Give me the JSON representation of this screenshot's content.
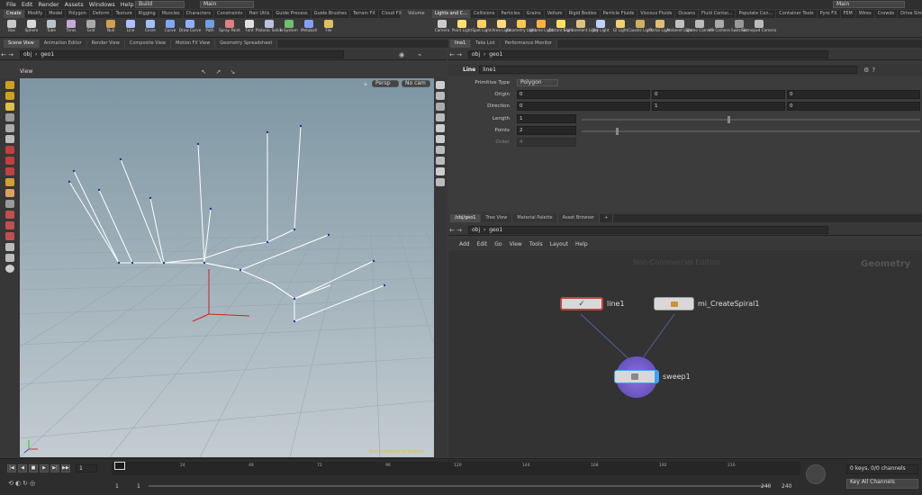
{
  "menu": {
    "items": [
      "File",
      "Edit",
      "Render",
      "Assets",
      "Windows",
      "Help"
    ],
    "build": "Build",
    "desktop": "Main",
    "right_desktop": "Main"
  },
  "shelf_tabs_left": [
    "Create",
    "Modify",
    "Model",
    "Polygon",
    "Deform",
    "Texture",
    "Rigging",
    "Muscles",
    "Characters",
    "Constraints",
    "Hair Utils",
    "Guide Process",
    "Guide Brushes",
    "Terrain FX",
    "Cloud FX",
    "Volume"
  ],
  "shelf_tabs_right": [
    "Lights and C...",
    "Collisions",
    "Particles",
    "Grains",
    "Vellum",
    "Rigid Bodies",
    "Particle Fluids",
    "Viscous Fluids",
    "Oceans",
    "Fluid Contai...",
    "Populate Con...",
    "Container Tools",
    "Pyro FX",
    "FEM",
    "Wires",
    "Crowds",
    "Drive Simula..."
  ],
  "tools_left": [
    {
      "label": "Box",
      "color": "#c9c9c9"
    },
    {
      "label": "Sphere",
      "color": "#d9d9d9"
    },
    {
      "label": "Tube",
      "color": "#b8c4cc"
    },
    {
      "label": "Torus",
      "color": "#c7a8d8"
    },
    {
      "label": "Grid",
      "color": "#a9a9a9"
    },
    {
      "label": "Null",
      "color": "#d0a050"
    },
    {
      "label": "Line",
      "color": "#b0c0ff"
    },
    {
      "label": "Circle",
      "color": "#a0c0ff"
    },
    {
      "label": "Curve",
      "color": "#7fa8ff"
    },
    {
      "label": "Draw Curve",
      "color": "#8fb0ff"
    },
    {
      "label": "Path",
      "color": "#6fa0e0"
    },
    {
      "label": "Spray Paint",
      "color": "#e08080"
    },
    {
      "label": "Font",
      "color": "#e0e0e0"
    },
    {
      "label": "Platonic Solids",
      "color": "#c0c0e0"
    },
    {
      "label": "L-System",
      "color": "#70c070"
    },
    {
      "label": "Metaball",
      "color": "#80a0ff"
    },
    {
      "label": "File",
      "color": "#e0c060"
    }
  ],
  "tools_right": [
    {
      "label": "Camera",
      "color": "#cccccc"
    },
    {
      "label": "Point Light",
      "color": "#ffe070"
    },
    {
      "label": "Spot Light",
      "color": "#ffd060"
    },
    {
      "label": "Area Light",
      "color": "#ffd880"
    },
    {
      "label": "Geometry Light",
      "color": "#ffc850"
    },
    {
      "label": "Volume Light",
      "color": "#ffb040"
    },
    {
      "label": "Distant Light",
      "color": "#ffe060"
    },
    {
      "label": "Environment Light",
      "color": "#e0c080"
    },
    {
      "label": "Sky Light",
      "color": "#c0d0ff"
    },
    {
      "label": "GI Light",
      "color": "#f0d070"
    },
    {
      "label": "Caustic Light",
      "color": "#d0b060"
    },
    {
      "label": "Portal Light",
      "color": "#e0c070"
    },
    {
      "label": "Ambient Light",
      "color": "#c0c0c0"
    },
    {
      "label": "Stereo Camera",
      "color": "#bbbbbb"
    },
    {
      "label": "VR Camera",
      "color": "#aaaaaa"
    },
    {
      "label": "Switcher",
      "color": "#999999"
    },
    {
      "label": "Gamepad Camera",
      "color": "#bbbbbb"
    }
  ],
  "viewer": {
    "tabs": [
      "Scene View",
      "Animation Editor",
      "Render View",
      "Composite View",
      "Motion FX View",
      "Geometry Spreadsheet"
    ],
    "path_obj": "obj",
    "path_geo": "geo1",
    "view_label": "View",
    "persp": "Persp",
    "cam": "No cam",
    "watermark": "Non-Commercial Edition"
  },
  "params": {
    "tabs": [
      "line1",
      "Take List",
      "Performance Monitor"
    ],
    "path_obj": "obj",
    "path_geo": "geo1",
    "node_type": "Line",
    "node_name": "line1",
    "primitive_type_label": "Primitive Type",
    "primitive_type_value": "Polygon",
    "origin_label": "Origin",
    "origin": [
      "0",
      "0",
      "0"
    ],
    "direction_label": "Direction",
    "direction": [
      "0",
      "1",
      "0"
    ],
    "length_label": "Length",
    "length": "1",
    "length_fraction": 0.43,
    "points_label": "Points",
    "points": "2",
    "points_fraction": 0.1,
    "order_label": "Order",
    "order": "4"
  },
  "network": {
    "tabs": [
      "/obj/geo1",
      "Tree View",
      "Material Palette",
      "Asset Browser"
    ],
    "path_obj": "obj",
    "path_geo": "geo1",
    "menu": [
      "Add",
      "Edit",
      "Go",
      "View",
      "Tools",
      "Layout",
      "Help"
    ],
    "watermark": "Non-Commercial Edition",
    "context": "Geometry",
    "nodes": {
      "line1": "line1",
      "spiral": "mi_CreateSpiral1",
      "sweep": "sweep1"
    }
  },
  "timeline": {
    "frame": "1",
    "ticks": [
      "1",
      "24",
      "48",
      "72",
      "96",
      "120",
      "144",
      "168",
      "192",
      "216"
    ],
    "start": "1",
    "start2": "1",
    "end": "240",
    "end2": "240",
    "keys": "0 keys, 0/0 channels",
    "key_all": "Key All Channels"
  }
}
